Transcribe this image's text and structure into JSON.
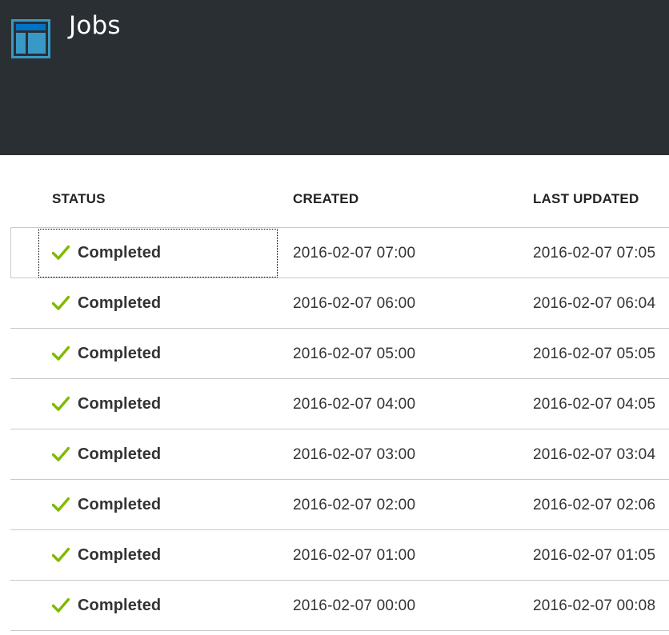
{
  "header": {
    "title": "Jobs",
    "icon": "jobs-blade-icon"
  },
  "columns": {
    "status": "STATUS",
    "created": "CREATED",
    "last_updated": "LAST UPDATED"
  },
  "colors": {
    "header_bg": "#2a2f33",
    "icon_blue": "#3999c6",
    "check_green": "#7fba00"
  },
  "rows": [
    {
      "status": "Completed",
      "created": "2016-02-07 07:00",
      "last_updated": "2016-02-07 07:05",
      "selected": true
    },
    {
      "status": "Completed",
      "created": "2016-02-07 06:00",
      "last_updated": "2016-02-07 06:04"
    },
    {
      "status": "Completed",
      "created": "2016-02-07 05:00",
      "last_updated": "2016-02-07 05:05"
    },
    {
      "status": "Completed",
      "created": "2016-02-07 04:00",
      "last_updated": "2016-02-07 04:05"
    },
    {
      "status": "Completed",
      "created": "2016-02-07 03:00",
      "last_updated": "2016-02-07 03:04"
    },
    {
      "status": "Completed",
      "created": "2016-02-07 02:00",
      "last_updated": "2016-02-07 02:06"
    },
    {
      "status": "Completed",
      "created": "2016-02-07 01:00",
      "last_updated": "2016-02-07 01:05"
    },
    {
      "status": "Completed",
      "created": "2016-02-07 00:00",
      "last_updated": "2016-02-07 00:08"
    }
  ]
}
